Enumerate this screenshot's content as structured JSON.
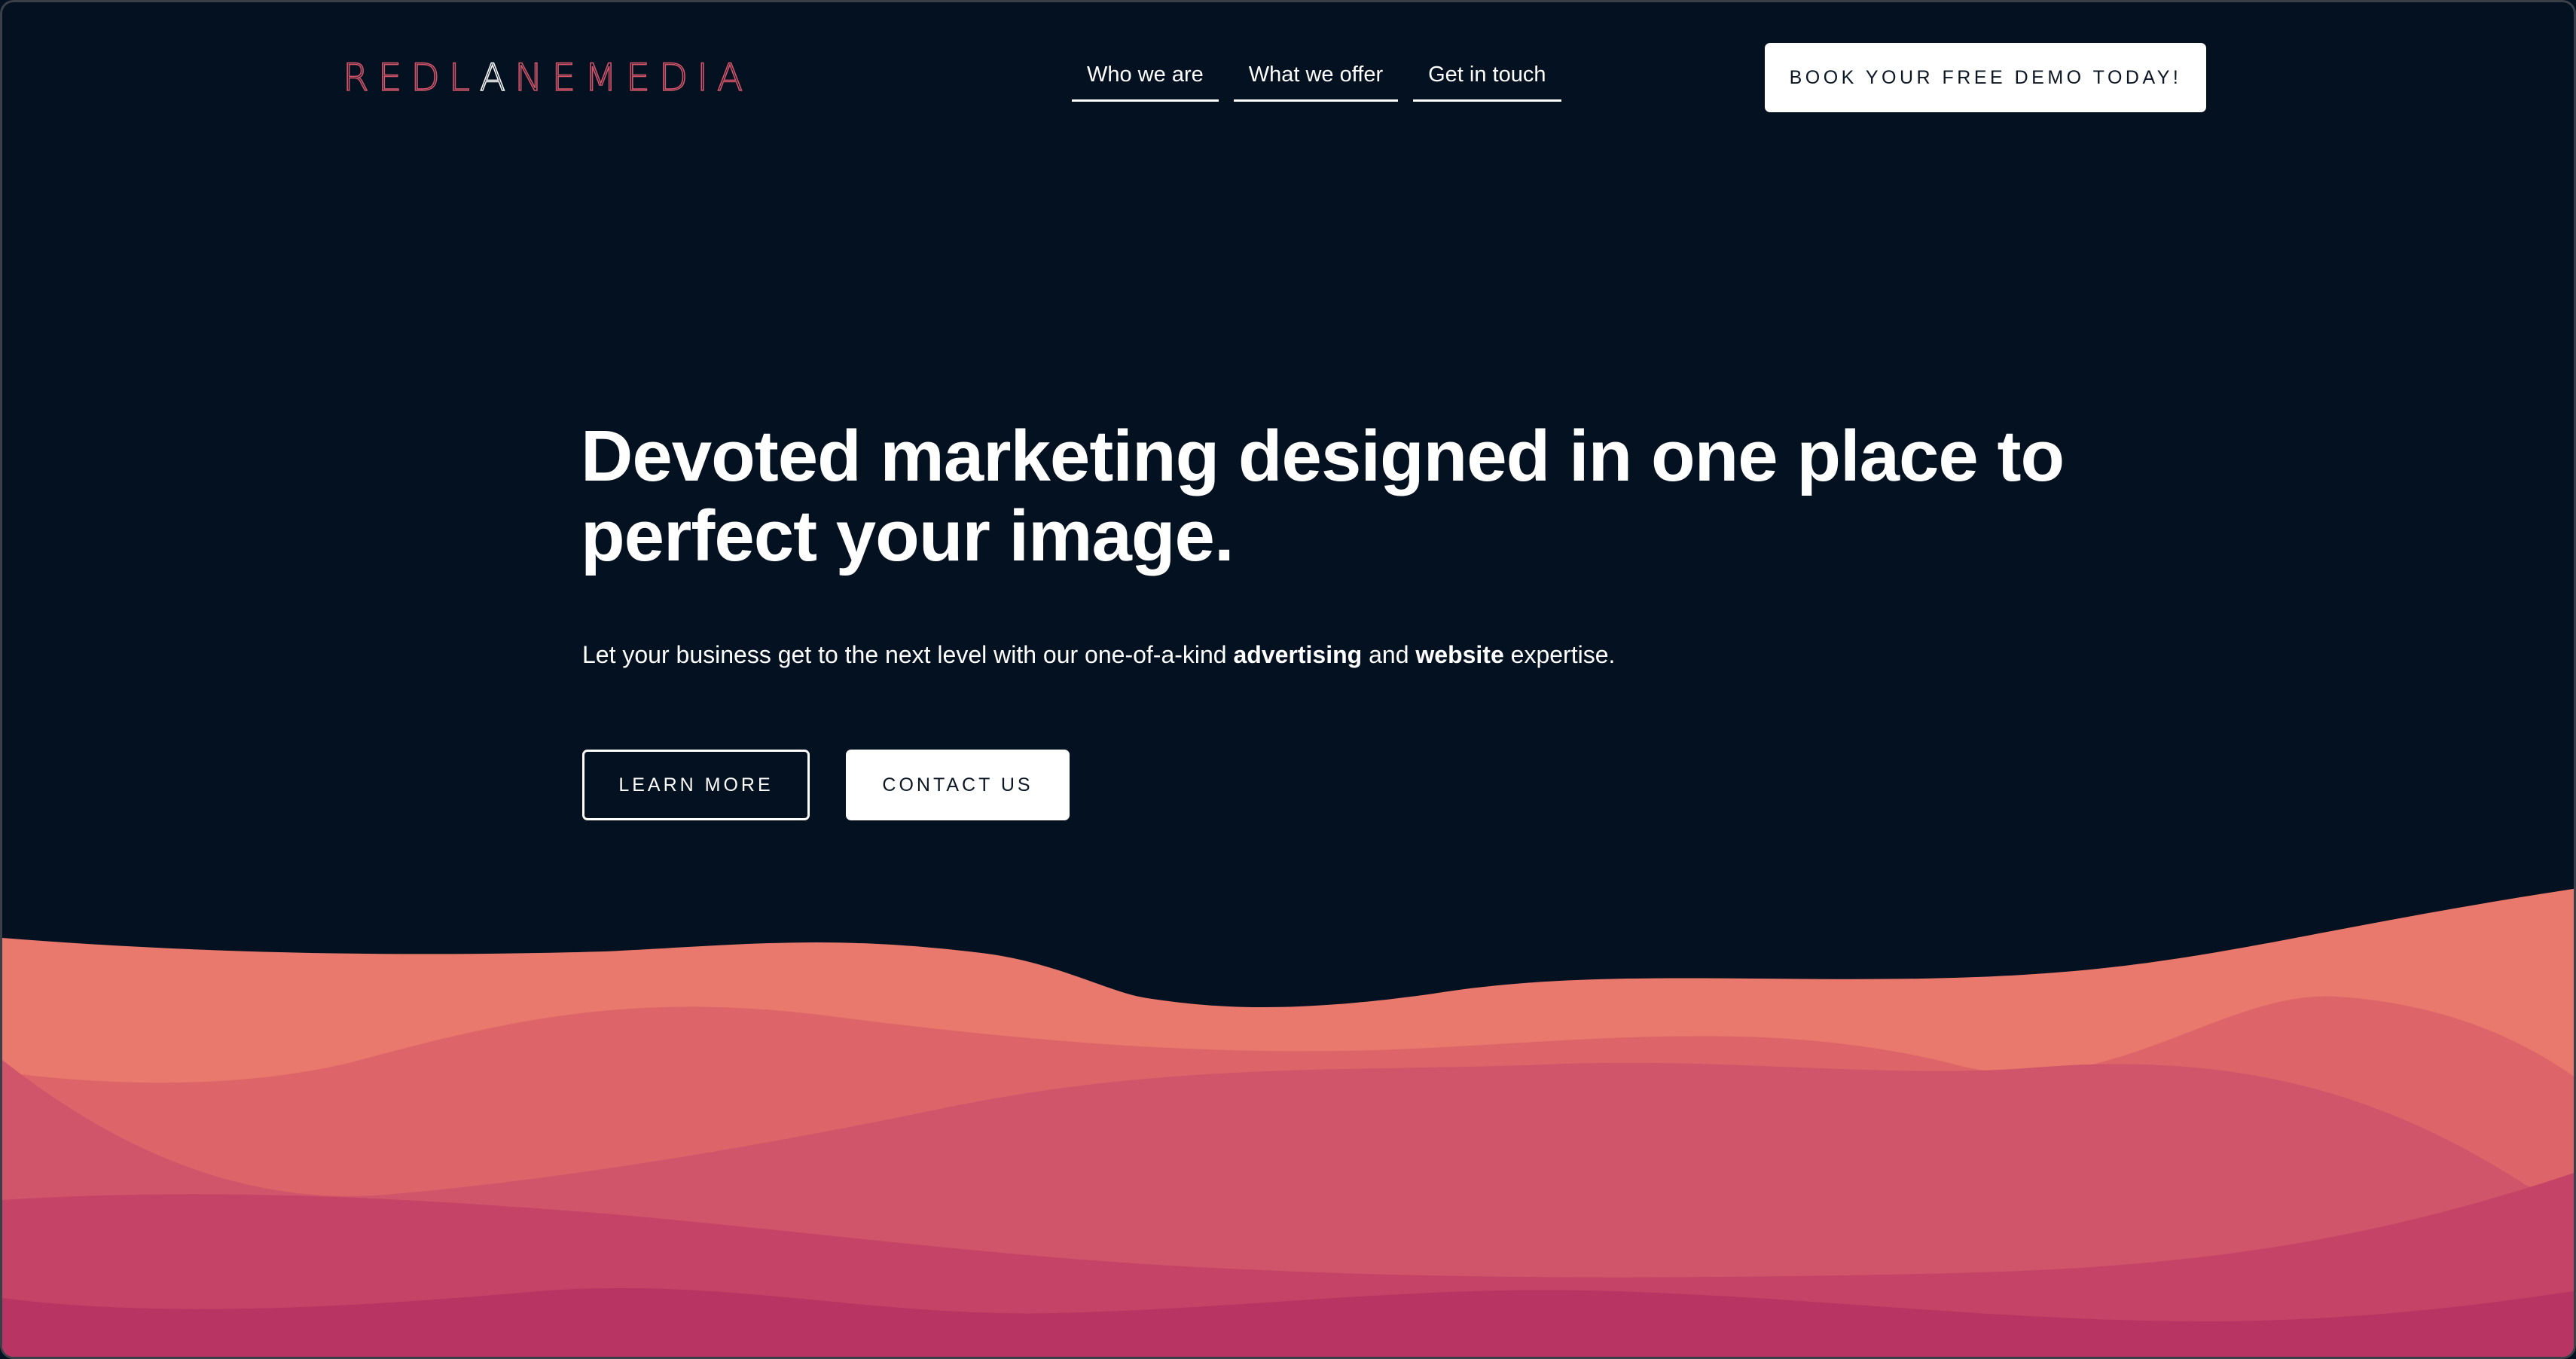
{
  "header": {
    "logo_text": "REDLANEMEDIA",
    "nav": [
      {
        "label": "Who we are"
      },
      {
        "label": "What we offer"
      },
      {
        "label": "Get in touch"
      }
    ],
    "demo_button": "BOOK YOUR FREE DEMO TODAY!"
  },
  "hero": {
    "title": "Devoted marketing designed in one place to perfect your image.",
    "subtitle_prefix": "Let your business get to the next level with our one-of-a-kind ",
    "subtitle_bold_1": "advertising",
    "subtitle_middle": " and ",
    "subtitle_bold_2": "website",
    "subtitle_suffix": " expertise.",
    "learn_more": "LEARN MORE",
    "contact_us": "CONTACT US"
  },
  "colors": {
    "background": "#041120",
    "logo_accent": "#d2556a",
    "wave_1": "#e8796c",
    "wave_2": "#dd6468",
    "wave_3": "#d0546a",
    "wave_4": "#c44366",
    "wave_5": "#b83462"
  }
}
